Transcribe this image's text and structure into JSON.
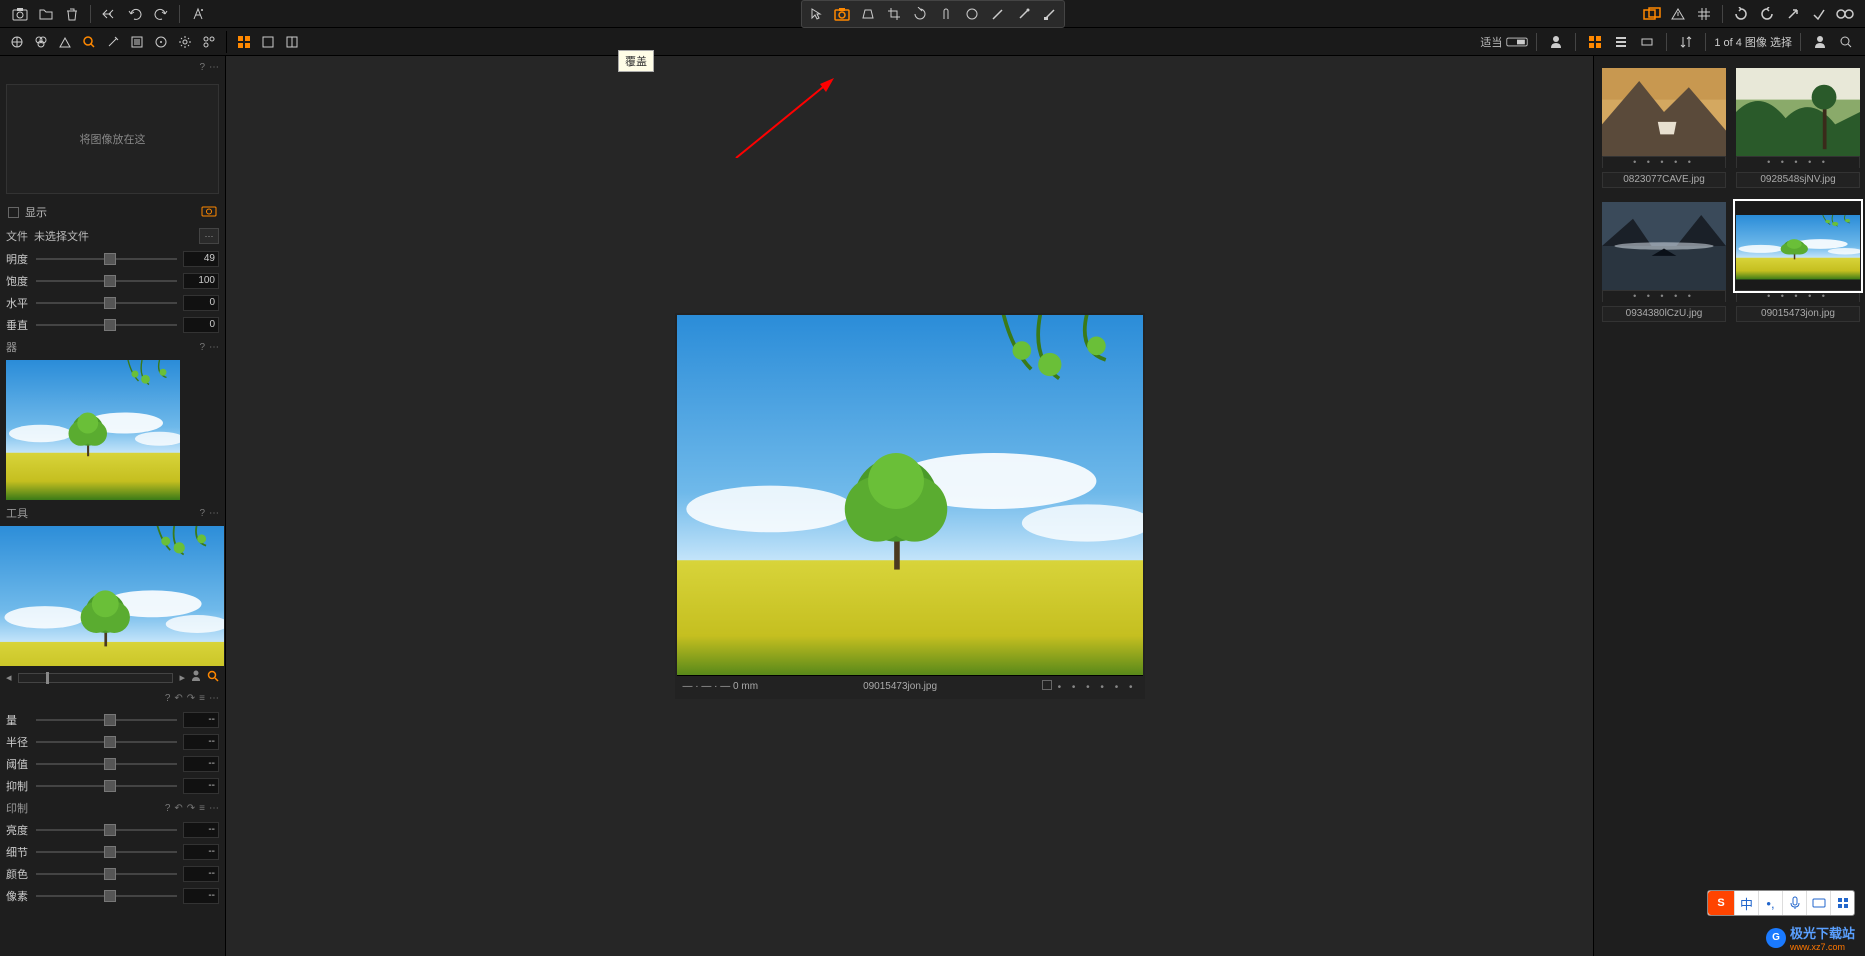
{
  "toolbar": {
    "ruler_mm": "— · — · —  0 mm",
    "center_filename": "09015473jon.jpg"
  },
  "tooltip": "覆盖",
  "subbar": {
    "fit_label": "适当",
    "status_text": "1 of 4 图像 选择"
  },
  "left": {
    "dropzone": "将图像放在这",
    "show_label": "显示",
    "file_label": "文件",
    "file_value": "未选择文件",
    "s1_label": "明度",
    "s1_val": "49",
    "s2_label": "饱度",
    "s2_val": "100",
    "s3_label": "水平",
    "s3_val": "0",
    "s4_label": "垂直",
    "s4_val": "0",
    "panel2_title": "器",
    "panel3_title": "工具",
    "adj1": "量",
    "adj2": "半径",
    "adj3": "阈值",
    "adj4": "抑制",
    "adj_dash": "--",
    "grp2": "印制",
    "grp2a": "亮度",
    "grp2b": "细节",
    "grp2c": "颜色",
    "grp2d": "像素"
  },
  "thumbs": [
    {
      "file": "0823077CAVE.jpg"
    },
    {
      "file": "0928548sjNV.jpg"
    },
    {
      "file": "0934380lCzU.jpg"
    },
    {
      "file": "09015473jon.jpg"
    }
  ],
  "watermark": {
    "text": "极光下载站",
    "url": "www.xz7.com"
  },
  "ime": {
    "zh": "中"
  }
}
